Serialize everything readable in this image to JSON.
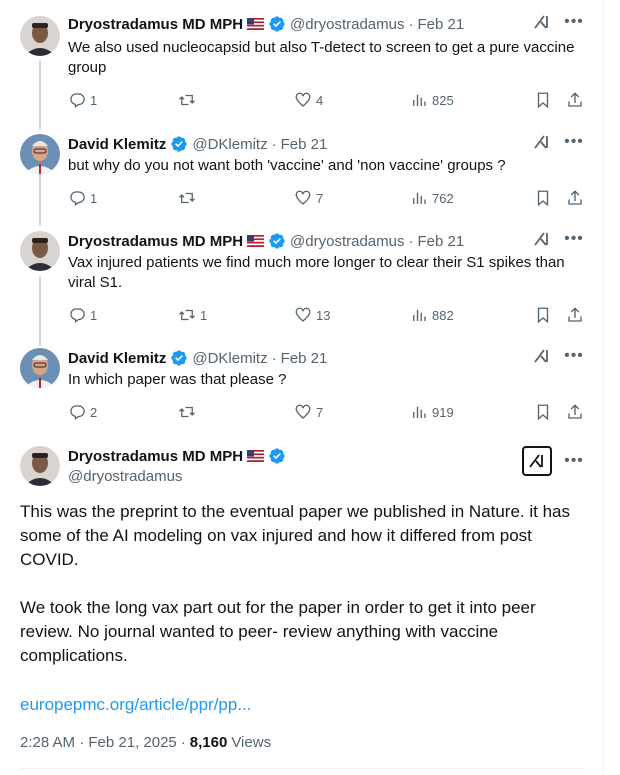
{
  "thread": [
    {
      "name": "Dryostradamus MD MPH",
      "flag": true,
      "handle": "@dryostradamus",
      "date": "Feb 21",
      "text": "We also used nucleocapsid but also T-detect to screen to get a pure vaccine group",
      "replies": "1",
      "retweets": "",
      "likes": "4",
      "views": "825"
    },
    {
      "name": "David Klemitz",
      "flag": false,
      "handle": "@DKlemitz",
      "date": "Feb 21",
      "text": "but why do you not want both 'vaccine' and 'non vaccine' groups ?",
      "replies": "1",
      "retweets": "",
      "likes": "7",
      "views": "762"
    },
    {
      "name": "Dryostradamus MD MPH",
      "flag": true,
      "handle": "@dryostradamus",
      "date": "Feb 21",
      "text": "Vax injured patients we find much more longer to clear their S1 spikes than viral S1.",
      "replies": "1",
      "retweets": "1",
      "likes": "13",
      "views": "882"
    },
    {
      "name": "David Klemitz",
      "flag": false,
      "handle": "@DKlemitz",
      "date": "Feb 21",
      "text": "In which paper was that please ?",
      "replies": "2",
      "retweets": "",
      "likes": "7",
      "views": "919"
    }
  ],
  "main": {
    "name": "Dryostradamus MD MPH",
    "handle": "@dryostradamus",
    "paragraph1": "This was the preprint to the eventual paper we published in Nature.  it has some of the AI modeling on vax injured and how it differed from post COVID.",
    "paragraph2": "We took the long vax part out for the paper in order to get it into peer review.  No journal wanted to peer- review anything with vaccine complications.",
    "link": "europepmc.org/article/ppr/pp...",
    "time": "2:28 AM · Feb 21, 2025",
    "views_count": "8,160",
    "views_label": "Views"
  },
  "colors": {
    "verified": "#1d9bf0",
    "secondary_text": "#536471",
    "link": "#1d9bf0"
  },
  "icons": {
    "reply": "reply-icon",
    "retweet": "retweet-icon",
    "like": "heart-icon",
    "views": "views-icon",
    "bookmark": "bookmark-icon",
    "share": "share-icon",
    "grok": "grok-icon",
    "more": "more-icon"
  }
}
